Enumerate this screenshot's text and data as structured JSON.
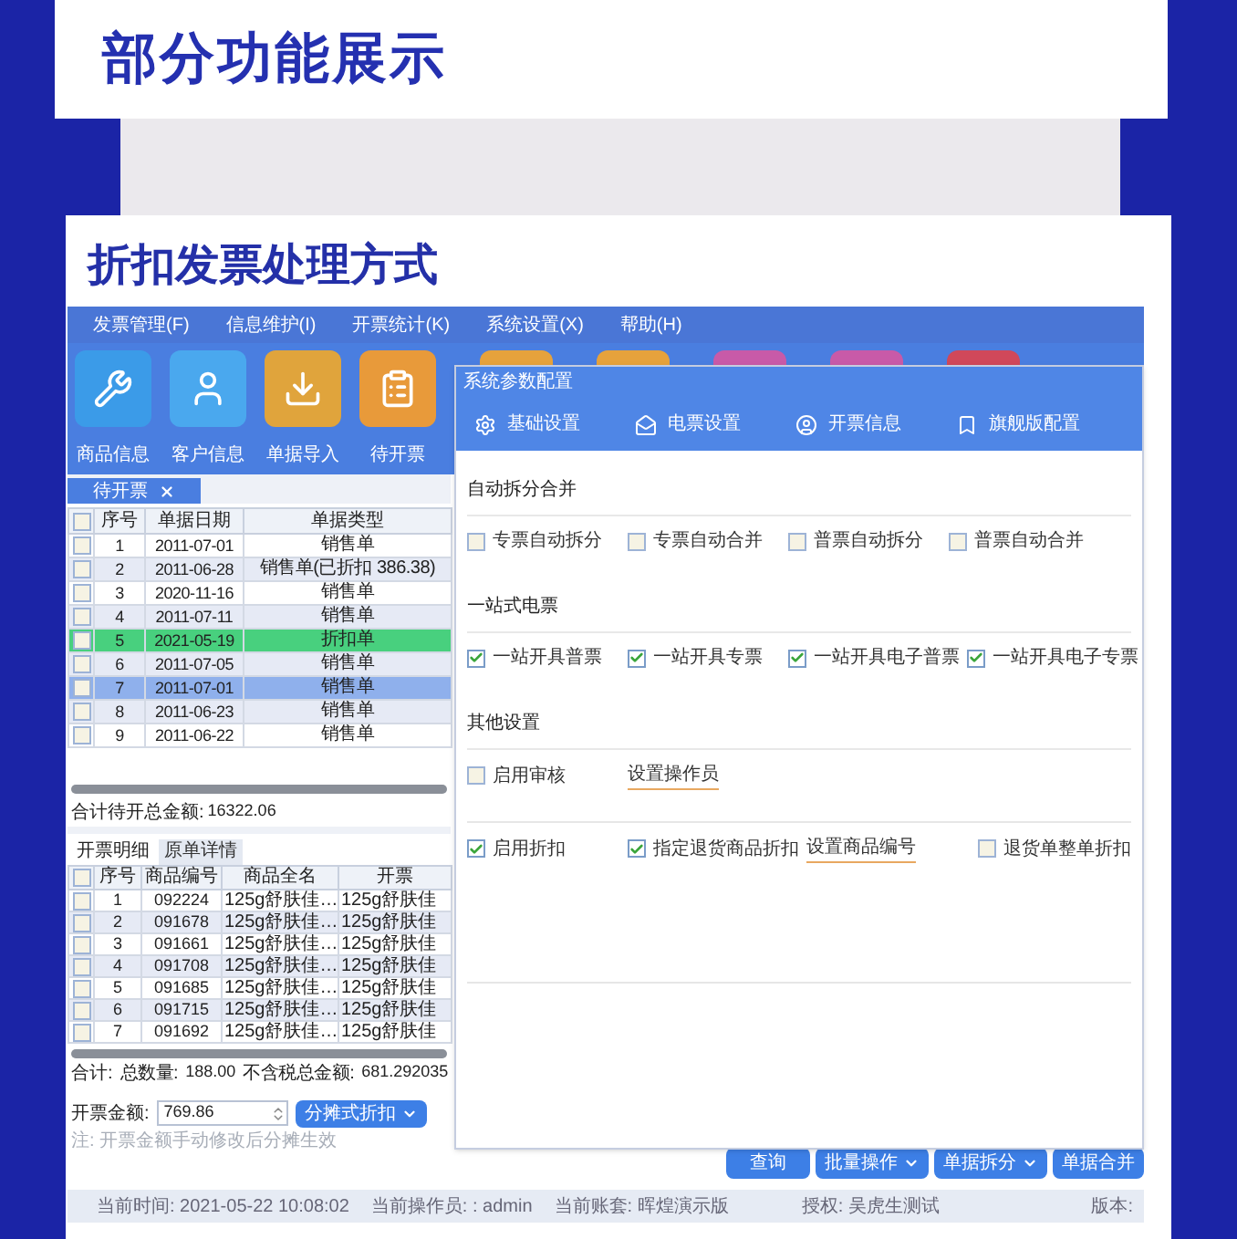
{
  "banner": {
    "title": "部分功能展示"
  },
  "section": {
    "title": "折扣发票处理方式"
  },
  "app": {
    "menu": [
      "发票管理(F)",
      "信息维护(I)",
      "开票统计(K)",
      "系统设置(X)",
      "帮助(H)"
    ],
    "toolbar": [
      {
        "label": "商品信息",
        "kind": "tools"
      },
      {
        "label": "客户信息",
        "kind": "person"
      },
      {
        "label": "单据导入",
        "kind": "import"
      },
      {
        "label": "待开票",
        "kind": "list"
      }
    ],
    "doc_tab": {
      "label": "待开票"
    },
    "pending_table": {
      "header_checked": false,
      "columns": [
        "序号",
        "单据日期",
        "单据类型"
      ],
      "rows": [
        {
          "cells": [
            "1",
            "2011-07-01",
            "销售单"
          ],
          "checked": false,
          "kind": "sale",
          "selected": false
        },
        {
          "cells": [
            "2",
            "2011-06-28",
            "销售单(已折扣 386.38)"
          ],
          "checked": false,
          "kind": "sale",
          "selected": false
        },
        {
          "cells": [
            "3",
            "2020-11-16",
            "销售单"
          ],
          "checked": false,
          "kind": "sale",
          "selected": false
        },
        {
          "cells": [
            "4",
            "2011-07-11",
            "销售单"
          ],
          "checked": false,
          "kind": "sale",
          "selected": false
        },
        {
          "cells": [
            "5",
            "2021-05-19",
            "折扣单"
          ],
          "checked": false,
          "kind": "discount",
          "selected": false
        },
        {
          "cells": [
            "6",
            "2011-07-05",
            "销售单"
          ],
          "checked": false,
          "kind": "sale",
          "selected": false
        },
        {
          "cells": [
            "7",
            "2011-07-01",
            "销售单"
          ],
          "checked": false,
          "kind": "sale",
          "selected": true
        },
        {
          "cells": [
            "8",
            "2011-06-23",
            "销售单"
          ],
          "checked": false,
          "kind": "sale",
          "selected": false
        },
        {
          "cells": [
            "9",
            "2011-06-22",
            "销售单"
          ],
          "checked": false,
          "kind": "sale",
          "selected": false
        }
      ]
    },
    "pending_total": {
      "label": "合计待开总金额:",
      "value": "16322.06"
    },
    "detail_tabs": [
      {
        "label": "开票明细",
        "selected": true
      },
      {
        "label": "原单详情",
        "selected": false
      }
    ],
    "detail_table": {
      "header_checked": false,
      "columns": [
        "序号",
        "商品编号",
        "商品全名",
        "开票"
      ],
      "rows": [
        {
          "cells": [
            "1",
            "092224",
            "125g舒肤佳…",
            "125g舒肤佳"
          ],
          "checked": false
        },
        {
          "cells": [
            "2",
            "091678",
            "125g舒肤佳…",
            "125g舒肤佳"
          ],
          "checked": false
        },
        {
          "cells": [
            "3",
            "091661",
            "125g舒肤佳…",
            "125g舒肤佳"
          ],
          "checked": false
        },
        {
          "cells": [
            "4",
            "091708",
            "125g舒肤佳…",
            "125g舒肤佳"
          ],
          "checked": false
        },
        {
          "cells": [
            "5",
            "091685",
            "125g舒肤佳…",
            "125g舒肤佳"
          ],
          "checked": false
        },
        {
          "cells": [
            "6",
            "091715",
            "125g舒肤佳…",
            "125g舒肤佳"
          ],
          "checked": false
        },
        {
          "cells": [
            "7",
            "091692",
            "125g舒肤佳…",
            "125g舒肤佳"
          ],
          "checked": false
        }
      ]
    },
    "summary": {
      "label": "合计:",
      "qty_label": "总数量:",
      "qty": "188.00",
      "amount_label": "不含税总金额:",
      "amount": "681.292035"
    },
    "invoice_amount": {
      "label": "开票金额:",
      "value": "769.86"
    },
    "discount_button": "分摊式折扣",
    "note": "注: 开票金额手动修改后分摊生效",
    "dialog": {
      "title": "系统参数配置",
      "tabs": [
        {
          "label": "基础设置",
          "kind": "gear"
        },
        {
          "label": "电票设置",
          "kind": "mail"
        },
        {
          "label": "开票信息",
          "kind": "user"
        },
        {
          "label": "旗舰版配置",
          "kind": "bookmark"
        }
      ],
      "sections": [
        {
          "title": "自动拆分合并",
          "options": [
            {
              "kind": "checkbox",
              "label": "专票自动拆分",
              "checked": false
            },
            {
              "kind": "checkbox",
              "label": "专票自动合并",
              "checked": false
            },
            {
              "kind": "checkbox",
              "label": "普票自动拆分",
              "checked": false
            },
            {
              "kind": "checkbox",
              "label": "普票自动合并",
              "checked": false
            }
          ]
        },
        {
          "title": "一站式电票",
          "options": [
            {
              "kind": "checkbox",
              "label": "一站开具普票",
              "checked": true
            },
            {
              "kind": "checkbox",
              "label": "一站开具专票",
              "checked": true
            },
            {
              "kind": "checkbox",
              "label": "一站开具电子普票",
              "checked": true
            },
            {
              "kind": "checkbox",
              "label": "一站开具电子专票",
              "checked": true
            }
          ]
        },
        {
          "title": "其他设置",
          "options": [
            {
              "kind": "checkbox",
              "label": "启用审核",
              "checked": false
            },
            {
              "kind": "link",
              "label": "设置操作员"
            }
          ]
        },
        {
          "options": [
            {
              "kind": "checkbox",
              "label": "启用折扣",
              "checked": true
            },
            {
              "kind": "checkbox",
              "label": "指定退货商品折扣",
              "checked": true
            },
            {
              "kind": "link",
              "label": "设置商品编号"
            },
            {
              "kind": "checkbox",
              "label": "退货单整单折扣",
              "checked": false
            }
          ]
        }
      ]
    },
    "actions": [
      {
        "label": "查询",
        "dropdown": false
      },
      {
        "label": "批量操作",
        "dropdown": true
      },
      {
        "label": "单据拆分",
        "dropdown": true
      },
      {
        "label": "单据合并",
        "dropdown": false
      }
    ],
    "status": [
      "当前时间: 2021-05-22 10:08:02",
      "当前操作员: : admin",
      "当前账套: 晖煌演示版",
      "授权: 吴虎生测试",
      "版本:"
    ]
  }
}
